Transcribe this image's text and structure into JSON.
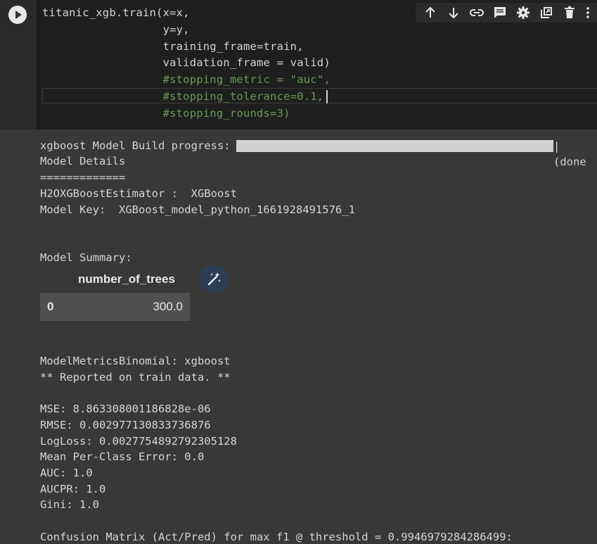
{
  "code": {
    "lines": [
      "titanic_xgb.train(x=x,",
      "                  y=y,",
      "                  training_frame=train,",
      "                  validation_frame = valid)",
      "                  #stopping_metric = \"auc\",",
      "                  #stopping_tolerance=0.1,",
      "                  #stopping_rounds=3)"
    ]
  },
  "toolbar": {
    "icons": [
      "arrow-up-icon",
      "arrow-down-icon",
      "link-icon",
      "comment-icon",
      "gear-icon",
      "mirror-icon",
      "trash-icon",
      "more-icon"
    ]
  },
  "output": {
    "progress_label": "xgboost Model Build progress: |",
    "progress_end": "| (done",
    "progress_percent": 100,
    "model_details": "Model Details",
    "underline": "=============",
    "estimator": "H2OXGBoostEstimator :  XGBoost",
    "model_key": "Model Key:  XGBoost_model_python_1661928491576_1",
    "summary_label": "Model Summary:",
    "table": {
      "header": "number_of_trees",
      "index": "0",
      "value": "300.0"
    },
    "metrics_title": "ModelMetricsBinomial: xgboost",
    "reported": "** Reported on train data. **",
    "mse": "MSE: 8.863308001186828e-06",
    "rmse": "RMSE: 0.002977130833736876",
    "logloss": "LogLoss: 0.0027754892792305128",
    "mpce": "Mean Per-Class Error: 0.0",
    "auc": "AUC: 1.0",
    "aucpr": "AUCPR: 1.0",
    "gini": "Gini: 1.0",
    "confusion": "Confusion Matrix (Act/Pred) for max f1 @ threshold = 0.9946979284286499:"
  }
}
